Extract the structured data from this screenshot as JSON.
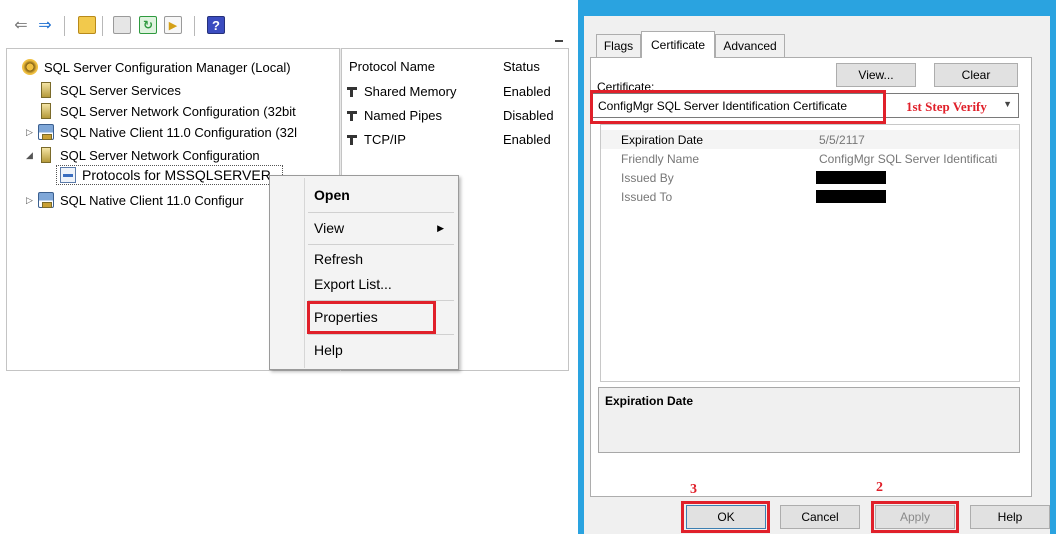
{
  "console": {
    "tree": {
      "root": "SQL Server Configuration Manager (Local)",
      "items": [
        "SQL Server Services",
        "SQL Server Network Configuration (32bit",
        "SQL Native Client 11.0 Configuration (32l",
        "SQL Server Network Configuration",
        "Protocols for MSSQLSERVER",
        "SQL Native Client 11.0 Configur"
      ]
    },
    "list": {
      "headers": {
        "name": "Protocol Name",
        "status": "Status"
      },
      "rows": [
        {
          "name": "Shared Memory",
          "status": "Enabled"
        },
        {
          "name": "Named Pipes",
          "status": "Disabled"
        },
        {
          "name": "TCP/IP",
          "status": "Enabled"
        }
      ]
    },
    "context_menu": {
      "items": [
        "Open",
        "View",
        "Refresh",
        "Export List...",
        "Properties",
        "Help"
      ],
      "highlighted": "Properties"
    }
  },
  "dialog": {
    "tabs": [
      "Flags",
      "Certificate",
      "Advanced"
    ],
    "active_tab": "Certificate",
    "certificate_label": "Certificate:",
    "view_button": "View...",
    "clear_button": "Clear",
    "selected_certificate": "ConfigMgr SQL Server Identification Certificate",
    "details": [
      {
        "key": "Expiration Date",
        "value": "5/5/2117",
        "selected": true
      },
      {
        "key": "Friendly Name",
        "value": "ConfigMgr SQL Server Identificati"
      },
      {
        "key": "Issued By",
        "value": "",
        "redacted": true
      },
      {
        "key": "Issued To",
        "value": "",
        "redacted": true
      }
    ],
    "description_title": "Expiration Date",
    "buttons": {
      "ok": "OK",
      "cancel": "Cancel",
      "apply": "Apply",
      "help": "Help"
    }
  },
  "annotations": {
    "step1": "1st Step Verify",
    "step2": "2",
    "step3": "3",
    "color": "#e0202a"
  },
  "icons": [
    "back-arrow-icon",
    "forward-arrow-icon",
    "up-folder-icon",
    "console-tree-icon",
    "refresh-icon",
    "export-icon",
    "help-icon"
  ]
}
